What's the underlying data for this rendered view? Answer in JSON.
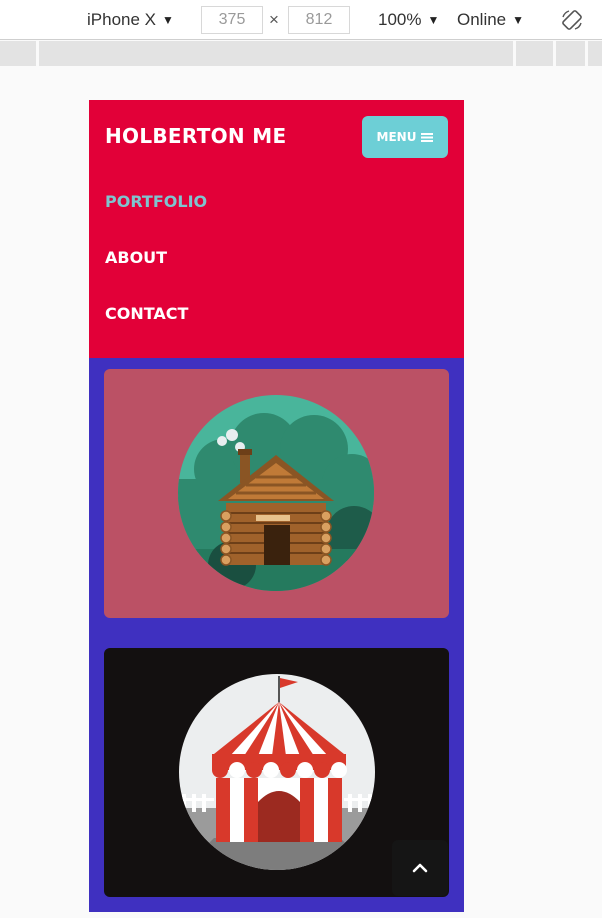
{
  "devtools": {
    "device": "iPhone X",
    "width": "375",
    "times": "×",
    "height": "812",
    "zoom": "100%",
    "network": "Online",
    "rotate_icon": "rotate-icon"
  },
  "site": {
    "brand": "HOLBERTON ME",
    "menu_label": "MENU",
    "menu_icon": "hamburger-icon",
    "nav": [
      {
        "label": "PORTFOLIO",
        "active": true
      },
      {
        "label": "ABOUT",
        "active": false
      },
      {
        "label": "CONTACT",
        "active": false
      }
    ],
    "cards": [
      {
        "illustration": "log-cabin",
        "background": "#bb5165"
      },
      {
        "illustration": "circus-tent",
        "background": "#131010"
      }
    ],
    "back_to_top_icon": "chevron-up-icon"
  },
  "colors": {
    "header": "#e20038",
    "page": "#3f30c0",
    "menu_button": "#6dcfd6",
    "active_link": "#7fc4cf"
  }
}
